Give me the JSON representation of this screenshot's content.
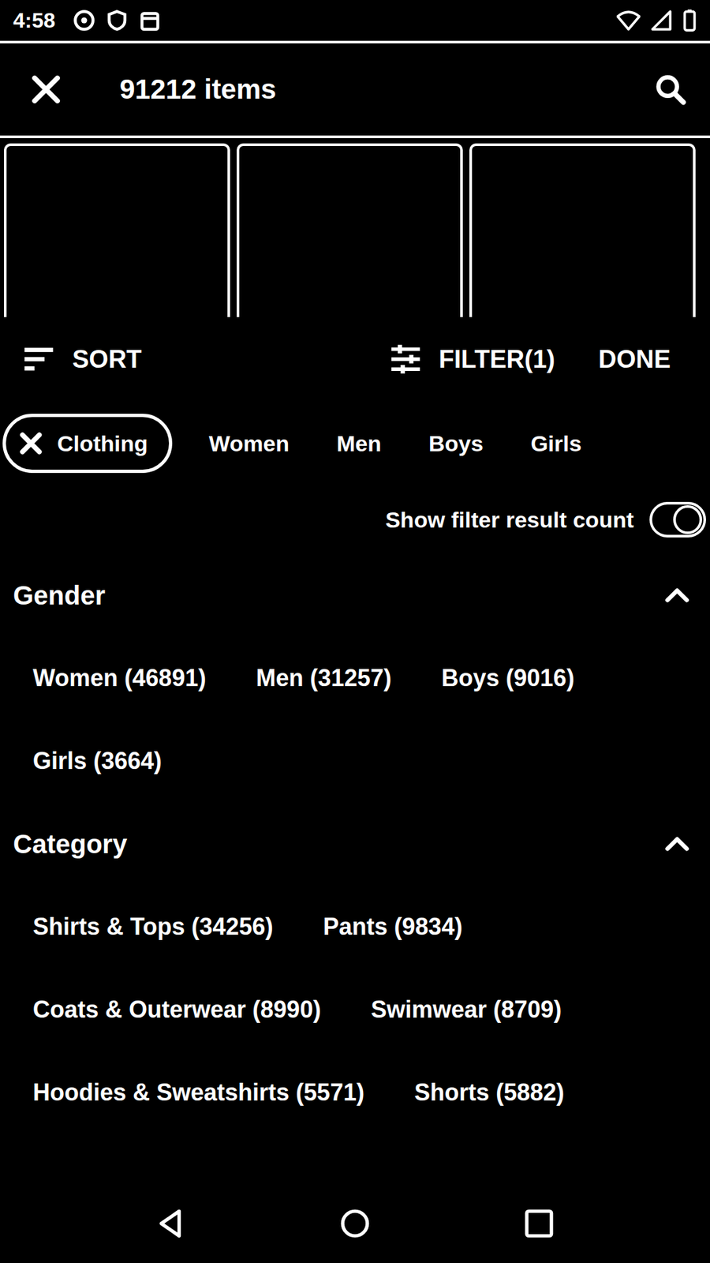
{
  "status_bar": {
    "time": "4:58"
  },
  "top_bar": {
    "title": "91212 items"
  },
  "toolbar": {
    "sort": "SORT",
    "filter": "FILTER(1)",
    "done": "DONE"
  },
  "chips": [
    {
      "label": "Clothing",
      "selected": true
    },
    {
      "label": "Women",
      "selected": false
    },
    {
      "label": "Men",
      "selected": false
    },
    {
      "label": "Boys",
      "selected": false
    },
    {
      "label": "Girls",
      "selected": false
    }
  ],
  "result_count_toggle": {
    "label": "Show filter result count",
    "on": true
  },
  "sections": [
    {
      "title": "Gender",
      "expanded": true,
      "options": [
        "Women (46891)",
        "Men (31257)",
        "Boys (9016)",
        "Girls (3664)"
      ]
    },
    {
      "title": "Category",
      "expanded": true,
      "options": [
        "Shirts & Tops (34256)",
        "Pants (9834)",
        "Coats & Outerwear (8990)",
        "Swimwear (8709)",
        "Hoodies & Sweatshirts (5571)",
        "Shorts (5882)"
      ]
    }
  ]
}
